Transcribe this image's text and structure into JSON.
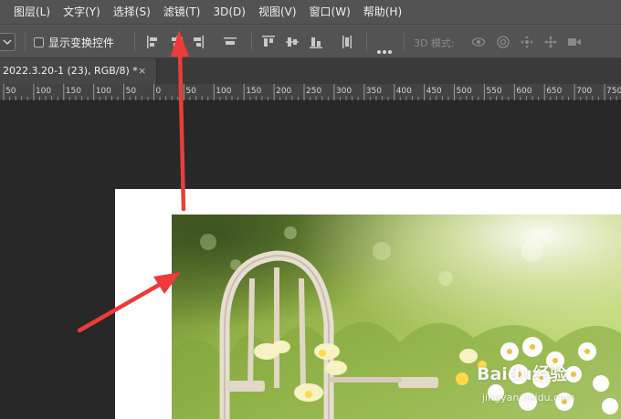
{
  "menubar": {
    "items": [
      "图层(L)",
      "文字(Y)",
      "选择(S)",
      "滤镜(T)",
      "3D(D)",
      "视图(V)",
      "窗口(W)",
      "帮助(H)"
    ]
  },
  "options": {
    "show_transform_label": "显示变换控件",
    "mode_label": "3D 模式:"
  },
  "tab": {
    "title": "2022.3.20-1 (23), RGB/8) *",
    "close": "×"
  },
  "ruler": {
    "labels": [
      "50",
      "100",
      "150",
      "100",
      "50",
      "0",
      "50",
      "100",
      "150",
      "200",
      "250",
      "300",
      "350",
      "400",
      "450",
      "500",
      "550",
      "600",
      "650",
      "700",
      "750"
    ]
  },
  "watermark": {
    "logo": "Baidu经验",
    "url": "jingyan.baidu.com"
  },
  "colors": {
    "annotation_arrow": "#f03a3a",
    "menubar_bg": "#535353",
    "workspace_bg": "#282828"
  }
}
